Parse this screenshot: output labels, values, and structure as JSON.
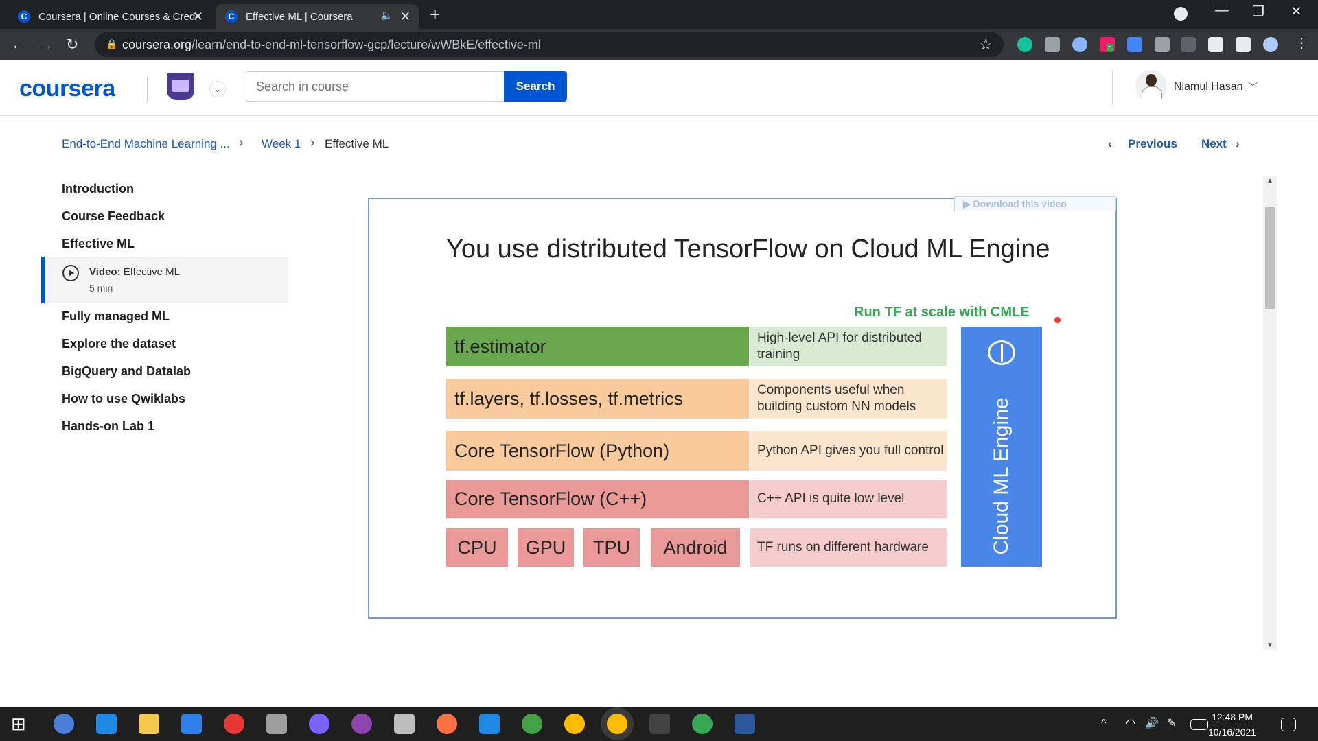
{
  "browser": {
    "tabs": [
      {
        "title": "Coursera | Online Courses & Credentials",
        "favicon": "C"
      },
      {
        "title": "Effective ML | Coursera",
        "favicon": "C"
      }
    ],
    "url_domain": "coursera.org",
    "url_path": "/learn/end-to-end-ml-tensorflow-gcp/lecture/wWBkE/effective-ml",
    "extension_badge": "5"
  },
  "header": {
    "logo": "coursera",
    "search_placeholder": "Search in course",
    "search_button": "Search",
    "user_name": "Niamul Hasan"
  },
  "breadcrumb": {
    "course": "End-to-End Machine Learning ...",
    "week": "Week 1",
    "current": "Effective ML"
  },
  "pager": {
    "previous": "Previous",
    "next": "Next"
  },
  "sidebar": {
    "items": [
      {
        "label": "Introduction"
      },
      {
        "label": "Course Feedback"
      },
      {
        "label": "Effective ML"
      },
      {
        "label": "Fully managed ML"
      },
      {
        "label": "Explore the dataset"
      },
      {
        "label": "BigQuery and Datalab"
      },
      {
        "label": "How to use Qwiklabs"
      },
      {
        "label": "Hands-on Lab 1"
      }
    ],
    "selected": {
      "type": "Video:",
      "title": "Effective ML",
      "duration": "5 min"
    }
  },
  "video": {
    "download_label": "▶ Download this video",
    "slide_title": "You use distributed TensorFlow on Cloud ML Engine",
    "run_label": "Run TF at scale with CMLE",
    "rows": [
      {
        "label": "tf.estimator",
        "desc": "High-level API for distributed training",
        "color": "#6aa84f",
        "desc_color": "#d9ead3"
      },
      {
        "label": "tf.layers, tf.losses, tf.metrics",
        "desc": "Components useful when building custom NN models",
        "color": "#f9cb9c",
        "desc_color": "#fce5cd"
      },
      {
        "label": "Core TensorFlow (Python)",
        "desc": "Python API gives you full control",
        "color": "#f9cb9c",
        "desc_color": "#fce5cd"
      },
      {
        "label": "Core TensorFlow (C++)",
        "desc": "C++ API is quite low level",
        "color": "#ea9999",
        "desc_color": "#f4cccc"
      }
    ],
    "hardware": [
      "CPU",
      "GPU",
      "TPU",
      "Android"
    ],
    "hardware_desc": "TF runs on different hardware",
    "engine_label": "Cloud ML Engine"
  },
  "taskbar": {
    "time": "12:48 PM",
    "date": "10/16/2021"
  }
}
